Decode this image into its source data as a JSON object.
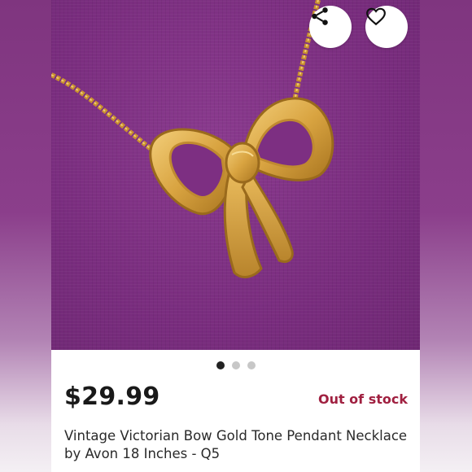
{
  "listing": {
    "price": "$29.99",
    "stock_status": "Out of stock",
    "title": "Vintage Victorian Bow Gold Tone Pendant Necklace by Avon 18 Inches - Q5"
  },
  "gallery": {
    "slide_count": 3,
    "active_slide": 1
  },
  "actions": {
    "share_icon": "share-icon",
    "favorite_icon": "heart-icon"
  },
  "colors": {
    "stock_status": "#a02040",
    "photo_background": "#7d2f82",
    "gold": "#d9a441"
  }
}
